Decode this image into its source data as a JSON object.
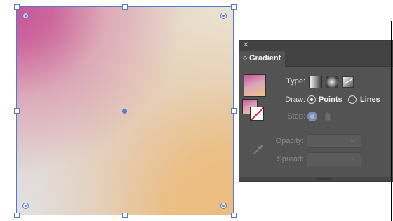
{
  "artboard": {
    "gradient_type": "freeform",
    "gradient_colors": [
      "#c85596",
      "#ebe3cf",
      "#e1e1e1",
      "#ecbd7c"
    ],
    "selection_color": "#4f7bd6"
  },
  "panel": {
    "close_glyph": "✕",
    "tab_chevron": "◇",
    "title": "Gradient",
    "type_label": "Type:",
    "type_options": [
      "linear-gradient",
      "radial-gradient",
      "freeform-gradient"
    ],
    "type_selected": "freeform-gradient",
    "draw_label": "Draw:",
    "draw_points": "Points",
    "draw_lines": "Lines",
    "draw_selected": "Points",
    "stop_label": "Stop:",
    "opacity_label": "Opacity:",
    "spread_label": "Spread:",
    "dropdown_chevron": "⌄",
    "colors": {
      "panel_bg": "#535353",
      "tab_bar": "#424242",
      "text": "#f0f0f0",
      "disabled": "#8a8a8a"
    }
  }
}
